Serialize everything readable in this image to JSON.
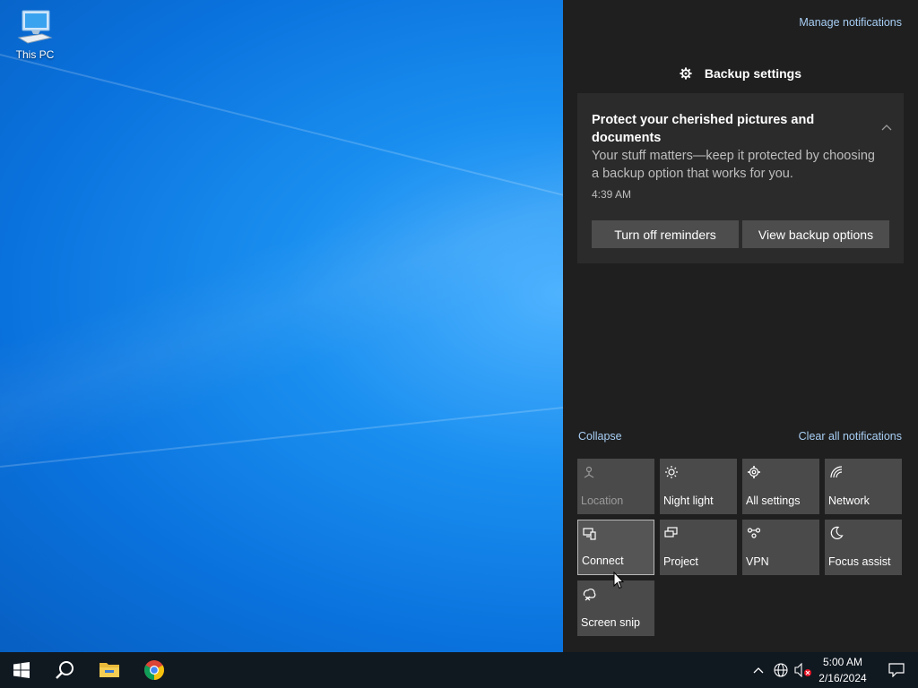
{
  "desktop": {
    "icons": [
      {
        "label": "This PC",
        "icon": "computer-icon"
      }
    ]
  },
  "action_center": {
    "manage_label": "Manage notifications",
    "group": {
      "icon": "gear-icon",
      "title": "Backup settings"
    },
    "notification": {
      "title": "Protect your cherished pictures and documents",
      "body": "Your stuff matters—keep it protected by choosing a backup option that works for you.",
      "time": "4:39 AM",
      "buttons": [
        "Turn off reminders",
        "View backup options"
      ]
    },
    "collapse_label": "Collapse",
    "clear_all_label": "Clear all notifications",
    "quick_actions": [
      {
        "label": "Location",
        "icon": "location-icon",
        "state": "disabled"
      },
      {
        "label": "Night light",
        "icon": "brightness-icon",
        "state": "off"
      },
      {
        "label": "All settings",
        "icon": "gear-icon",
        "state": "off"
      },
      {
        "label": "Network",
        "icon": "network-icon",
        "state": "off"
      },
      {
        "label": "Connect",
        "icon": "connect-icon",
        "state": "hover"
      },
      {
        "label": "Project",
        "icon": "project-icon",
        "state": "off"
      },
      {
        "label": "VPN",
        "icon": "vpn-icon",
        "state": "off"
      },
      {
        "label": "Focus assist",
        "icon": "moon-icon",
        "state": "off"
      },
      {
        "label": "Screen snip",
        "icon": "snip-icon",
        "state": "off"
      }
    ]
  },
  "taskbar": {
    "pinned": [
      "start-icon",
      "search-icon",
      "file-explorer-icon",
      "chrome-icon"
    ],
    "tray": [
      "chevron-up-icon",
      "globe-icon",
      "speaker-muted-icon"
    ],
    "time": "5:00 AM",
    "date": "2/16/2024"
  },
  "colors": {
    "accent": "#a8cff5",
    "panel": "#1f1f1f",
    "tile": "#4a4a4a",
    "taskbar": "#101820"
  }
}
